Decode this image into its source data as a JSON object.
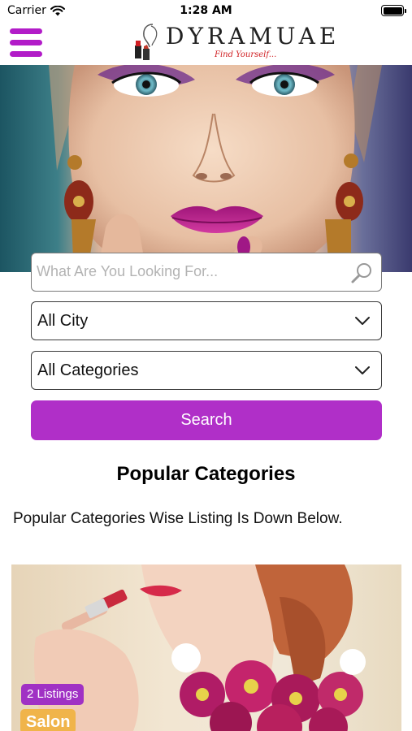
{
  "status_bar": {
    "carrier": "Carrier",
    "time": "1:28 AM",
    "wifi_icon": "wifi-icon",
    "battery_icon": "battery-icon"
  },
  "header": {
    "menu_icon": "hamburger-menu-icon",
    "logo": {
      "wordmark": "DYRAMUAE",
      "tagline": "Find Yourself...",
      "accent_color": "#d01e22"
    }
  },
  "hero": {
    "image": "woman-face-makeup-photo"
  },
  "search": {
    "placeholder": "What Are You Looking For...",
    "value": "",
    "icon": "search-icon"
  },
  "filters": {
    "city": {
      "selected": "All City",
      "icon": "chevron-down-icon"
    },
    "category": {
      "selected": "All Categories",
      "icon": "chevron-down-icon"
    }
  },
  "search_button": {
    "label": "Search",
    "color": "#b02fc8"
  },
  "popular": {
    "title": "Popular Categories",
    "subtitle": "Popular Categories Wise Listing Is Down Below."
  },
  "categories": [
    {
      "name": "Salon",
      "listings": "2 Listings",
      "badge_color": "#a031c4",
      "name_color": "#f0b44a"
    }
  ]
}
